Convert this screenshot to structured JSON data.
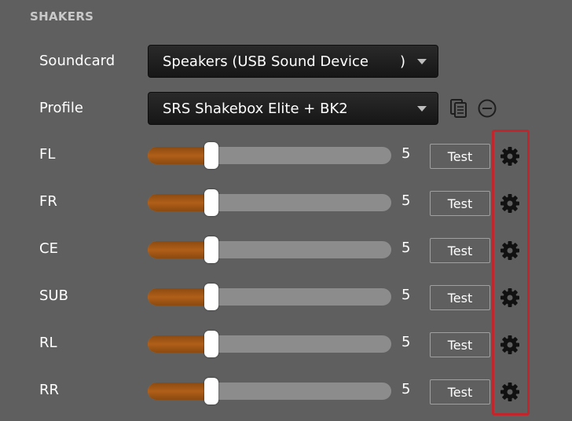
{
  "section": {
    "title": "SHAKERS"
  },
  "soundcard": {
    "label": "Soundcard",
    "value": "Speakers (USB Sound Device       )"
  },
  "profile": {
    "label": "Profile",
    "value": "SRS Shakebox Elite + BK2"
  },
  "channels": [
    {
      "label": "FL",
      "value": "5",
      "level": 0.26,
      "test_label": "Test"
    },
    {
      "label": "FR",
      "value": "5",
      "level": 0.26,
      "test_label": "Test"
    },
    {
      "label": "CE",
      "value": "5",
      "level": 0.26,
      "test_label": "Test"
    },
    {
      "label": "SUB",
      "value": "5",
      "level": 0.26,
      "test_label": "Test"
    },
    {
      "label": "RL",
      "value": "5",
      "level": 0.26,
      "test_label": "Test"
    },
    {
      "label": "RR",
      "value": "5",
      "level": 0.26,
      "test_label": "Test"
    }
  ],
  "icons": {
    "profile_copy": "copy-document-icon",
    "profile_remove": "minus-circle-icon",
    "channel_settings": "gear-icon"
  },
  "colors": {
    "background": "#5f5f5f",
    "slider_fill": "#b05f18",
    "highlight": "#c0262b"
  }
}
